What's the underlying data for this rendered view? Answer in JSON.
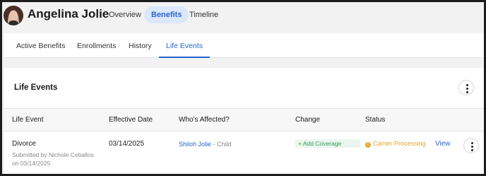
{
  "header": {
    "name": "Angelina Jolie",
    "nav": [
      "Overview",
      "Benefits",
      "Timeline"
    ],
    "active_nav": "Benefits"
  },
  "tabs": [
    {
      "label": "Active Benefits"
    },
    {
      "label": "Enrollments"
    },
    {
      "label": "History"
    },
    {
      "label": "Life Events",
      "active": true
    }
  ],
  "section": {
    "title": "Life Events"
  },
  "table": {
    "columns": [
      "Life Event",
      "Effective Date",
      "Who's Affected?",
      "Change",
      "Status"
    ],
    "rows": [
      {
        "event": "Divorce",
        "submitted_line1": "Submitted by Nichole Ceballos",
        "submitted_line2": "on 03/14/2025",
        "effective_date": "03/14/2025",
        "affected_name": "Shiloh Jolie",
        "affected_relation": "- Child",
        "change": "+ Add Coverage",
        "status_icon": "!",
        "status": "Carrier Processing",
        "action": "View"
      }
    ]
  },
  "colors": {
    "accent": "#2a66d0",
    "nav_active_bg": "#dbe7fb",
    "status_warning": "#e5a52a",
    "change_green": "#2e9a55",
    "change_bg": "#eaf6ee"
  },
  "icons": {
    "avatar": "user-avatar",
    "section_menu": "more-vertical-icon",
    "row_menu": "more-vertical-icon",
    "status": "warning-circle-icon"
  }
}
